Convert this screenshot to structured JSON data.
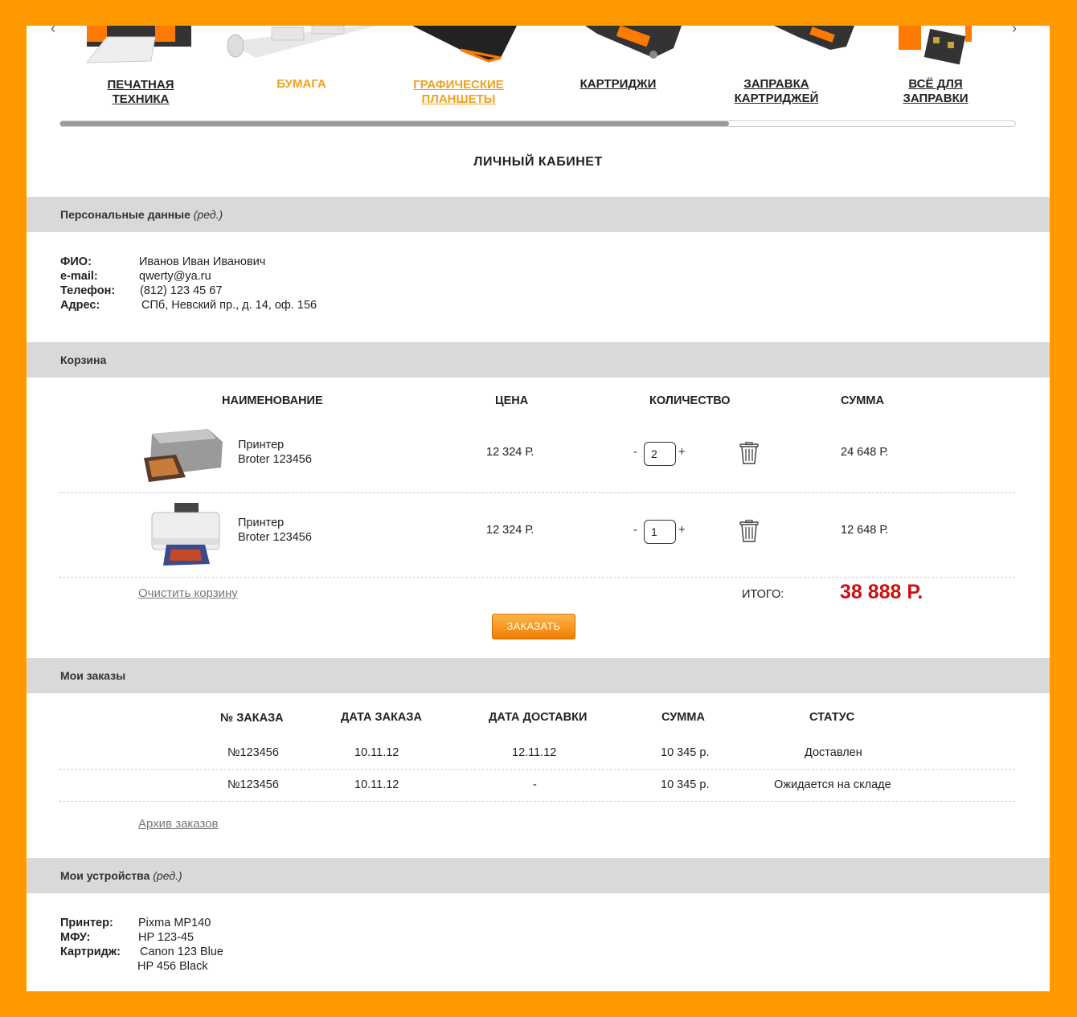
{
  "categories": [
    {
      "label": "ПЕЧАТНАЯ ТЕХНИКА",
      "icon": "printer-image"
    },
    {
      "label": "БУМАГА",
      "icon": "paper-roll-image"
    },
    {
      "label": "ГРАФИЧЕСКИЕ ПЛАНШЕТЫ",
      "icon": "tablet-image"
    },
    {
      "label": "КАРТРИДЖИ",
      "icon": "cartridge-image"
    },
    {
      "label": "ЗАПРАВКА КАРТРИДЖЕЙ",
      "icon": "cartridge-refill-image"
    },
    {
      "label": "ВСЁ ДЛЯ ЗАПРАВКИ",
      "icon": "refill-kit-image"
    }
  ],
  "carousel": {
    "scroll_fraction": 0.7
  },
  "page_title": "ЛИЧНЫЙ КАБИНЕТ",
  "personal": {
    "title": "Персональные данные",
    "edit": "(ред.)",
    "fields": [
      {
        "key": "ФИО:",
        "value": "Иванов Иван Иванович"
      },
      {
        "key": "e-mail:",
        "value": "qwerty@ya.ru"
      },
      {
        "key": "Телефон:",
        "value": "(812) 123 45 67"
      },
      {
        "key": "Адрес:",
        "value": "СПб, Невский пр., д. 14, оф. 156"
      }
    ]
  },
  "cart": {
    "title": "Корзина",
    "headers": {
      "name": "НАИМЕНОВАНИЕ",
      "price": "ЦЕНА",
      "qty": "КОЛИЧЕСТВО",
      "sum": "СУММА"
    },
    "items": [
      {
        "name1": "Принтер",
        "name2": "Broter 123456",
        "price": "12 324 Р.",
        "qty": "2",
        "sum": "24 648 Р."
      },
      {
        "name1": "Принтер",
        "name2": "Broter 123456",
        "price": "12 324 Р.",
        "qty": "1",
        "sum": "12 648 Р."
      }
    ],
    "minus": "-",
    "plus": "+",
    "clear": "Очистить корзину",
    "total_label": "ИТОГО:",
    "total_value": "38 888 Р.",
    "order_button": "ЗАКАЗАТЬ"
  },
  "orders": {
    "title": "Мои заказы",
    "headers": {
      "num": "№ ЗАКАЗА",
      "date": "ДАТА ЗАКАЗА",
      "delivery": "ДАТА ДОСТАВКИ",
      "sum": "СУММА",
      "status": "СТАТУС"
    },
    "rows": [
      {
        "num": "№123456",
        "date": "10.11.12",
        "delivery": "12.11.12",
        "sum": "10 345 р.",
        "status": "Доставлен"
      },
      {
        "num": "№123456",
        "date": "10.11.12",
        "delivery": "-",
        "sum": "10 345 р.",
        "status": "Ожидается на складе"
      }
    ],
    "archive": "Архив заказов"
  },
  "devices": {
    "title": "Мои устройства",
    "edit": "(ред.)",
    "fields": [
      {
        "key": "Принтер:",
        "value": "Pixma MP140"
      },
      {
        "key": "МФУ:",
        "value": "HP 123-45"
      },
      {
        "key": "Картридж:",
        "value": "Canon 123 Blue"
      },
      {
        "key": "",
        "value": "HP 456 Black"
      }
    ]
  },
  "colors": {
    "frame": "#ff9900",
    "accent_orange": "#f2a01e",
    "total_red": "#cc1111",
    "section_bg": "#d9d9d9"
  }
}
